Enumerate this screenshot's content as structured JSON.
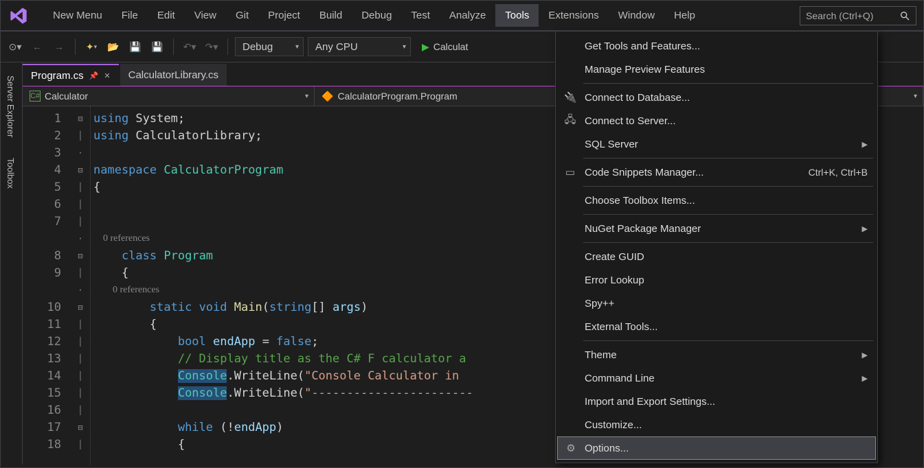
{
  "menubar": {
    "items": [
      "New Menu",
      "File",
      "Edit",
      "View",
      "Git",
      "Project",
      "Build",
      "Debug",
      "Test",
      "Analyze",
      "Tools",
      "Extensions",
      "Window",
      "Help"
    ],
    "active_index": 10,
    "search_placeholder": "Search (Ctrl+Q)"
  },
  "toolbar": {
    "config": "Debug",
    "platform": "Any CPU",
    "start_label": "Calculat"
  },
  "sidetabs": [
    "Server Explorer",
    "Toolbox"
  ],
  "filetabs": [
    {
      "label": "Program.cs",
      "active": true
    },
    {
      "label": "CalculatorLibrary.cs",
      "active": false
    }
  ],
  "navbar": {
    "left": "Calculator",
    "right": "CalculatorProgram.Program"
  },
  "editor": {
    "lines": [
      {
        "n": 1,
        "fold": "⊟",
        "html": "<span class='kw'>using</span> System;"
      },
      {
        "n": 2,
        "fold": "│",
        "html": "<span class='kw'>using</span> CalculatorLibrary;"
      },
      {
        "n": 3,
        "fold": "",
        "html": ""
      },
      {
        "n": 4,
        "fold": "⊟",
        "html": "<span class='kw'>namespace</span> <span class='type'>CalculatorProgram</span>"
      },
      {
        "n": 5,
        "fold": "│",
        "html": "{"
      },
      {
        "n": 6,
        "fold": "│",
        "html": ""
      },
      {
        "n": 7,
        "fold": "│",
        "html": ""
      },
      {
        "ref": true,
        "indent": "    ",
        "text": "0 references"
      },
      {
        "n": 8,
        "fold": "⊟",
        "html": "    <span class='kw'>class</span> <span class='type'>Program</span>"
      },
      {
        "n": 9,
        "fold": "│",
        "html": "    {"
      },
      {
        "ref": true,
        "indent": "        ",
        "text": "0 references"
      },
      {
        "n": 10,
        "fold": "⊟",
        "html": "        <span class='kw'>static</span> <span class='kw'>void</span> <span style='color:#dcdcaa'>Main</span>(<span class='kw'>string</span>[] <span class='ident'>args</span>)"
      },
      {
        "n": 11,
        "fold": "│",
        "html": "        {"
      },
      {
        "n": 12,
        "fold": "│",
        "html": "            <span class='kw'>bool</span> <span class='ident'>endApp</span> = <span class='kw'>false</span>;"
      },
      {
        "n": 13,
        "fold": "│",
        "html": "            <span class='cmt'>// Display title as the C# F calculator a</span>"
      },
      {
        "n": 14,
        "fold": "│",
        "html": "            <span class='type hl'>Console</span>.WriteLine(<span class='str'>\"Console Calculator in </span>"
      },
      {
        "n": 15,
        "fold": "│",
        "html": "            <span class='type hl'>Console</span>.WriteLine(<span class='dash-str'>\"-----------------------</span>"
      },
      {
        "n": 16,
        "fold": "│",
        "html": ""
      },
      {
        "n": 17,
        "fold": "⊟",
        "html": "            <span class='kw'>while</span> (!<span class='ident'>endApp</span>)"
      },
      {
        "n": 18,
        "fold": "│",
        "html": "            {"
      }
    ]
  },
  "dropdown": {
    "groups": [
      [
        {
          "label": "Get Tools and Features..."
        },
        {
          "label": "Manage Preview Features"
        }
      ],
      [
        {
          "label": "Connect to Database...",
          "icon": "db"
        },
        {
          "label": "Connect to Server...",
          "icon": "srv"
        },
        {
          "label": "SQL Server",
          "sub": true
        }
      ],
      [
        {
          "label": "Code Snippets Manager...",
          "icon": "snip",
          "shortcut": "Ctrl+K, Ctrl+B"
        }
      ],
      [
        {
          "label": "Choose Toolbox Items..."
        }
      ],
      [
        {
          "label": "NuGet Package Manager",
          "sub": true
        }
      ],
      [
        {
          "label": "Create GUID"
        },
        {
          "label": "Error Lookup"
        },
        {
          "label": "Spy++"
        },
        {
          "label": "External Tools..."
        }
      ],
      [
        {
          "label": "Theme",
          "sub": true
        },
        {
          "label": "Command Line",
          "sub": true
        },
        {
          "label": "Import and Export Settings..."
        },
        {
          "label": "Customize..."
        },
        {
          "label": "Options...",
          "icon": "gear",
          "hover": true
        }
      ]
    ]
  }
}
